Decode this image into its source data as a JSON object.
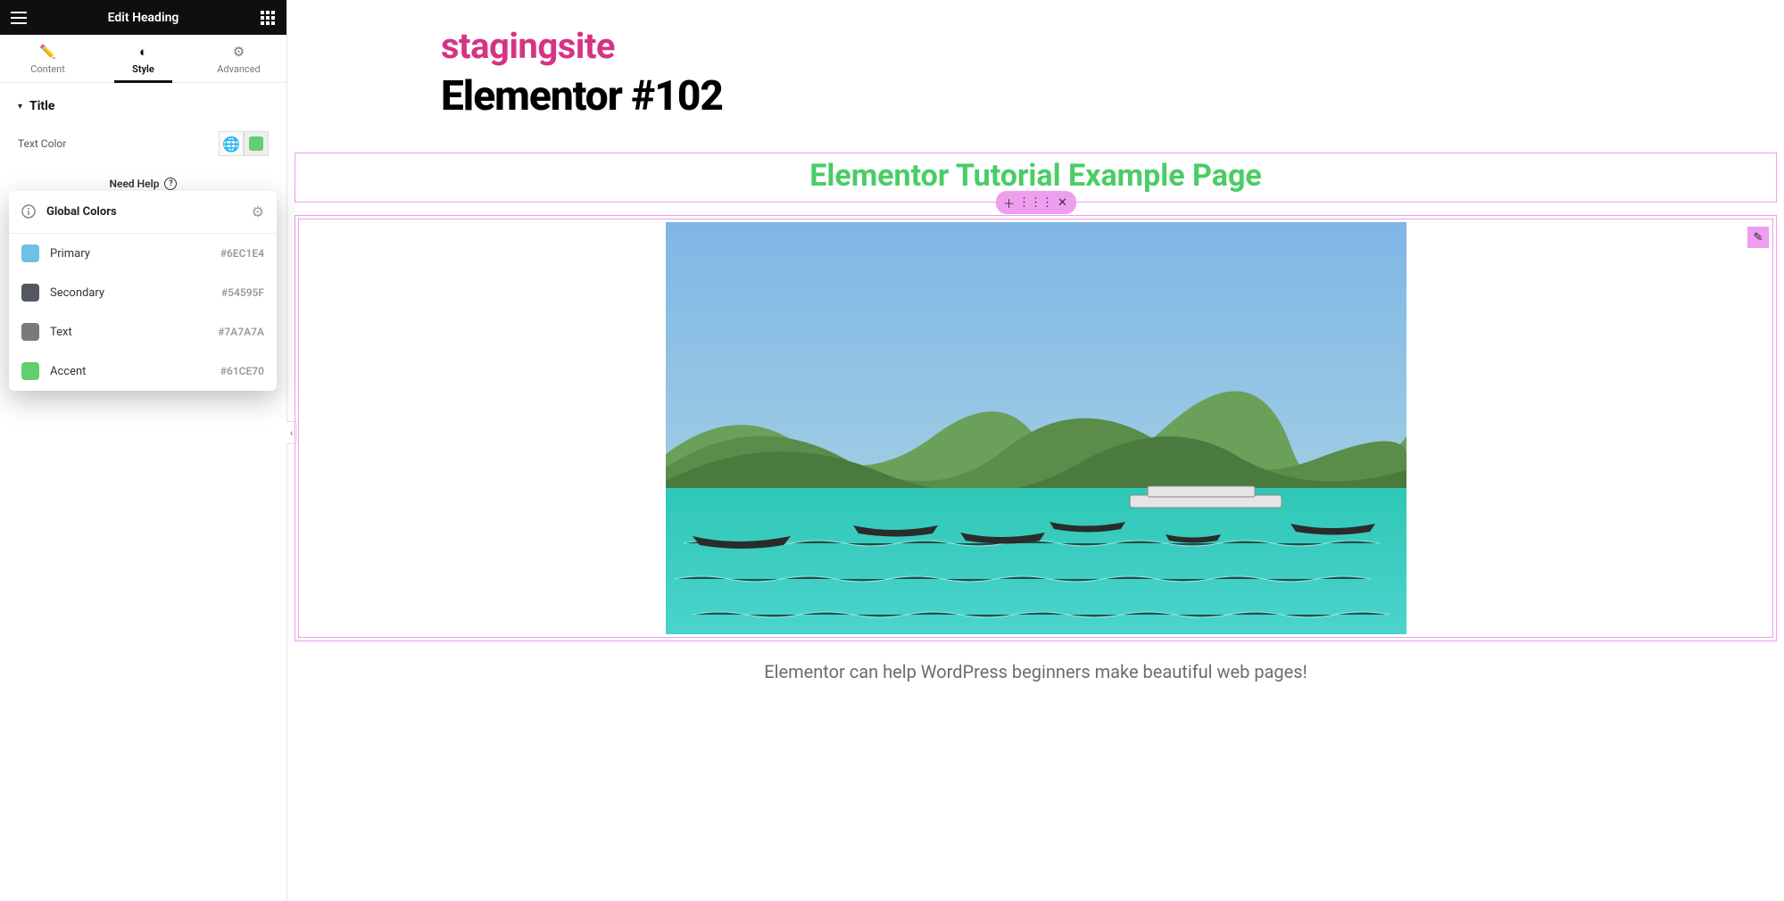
{
  "sidebar": {
    "header_title": "Edit Heading",
    "tabs": {
      "content": "Content",
      "style": "Style",
      "advanced": "Advanced"
    },
    "section": {
      "title": "Title"
    },
    "text_color_label": "Text Color",
    "selected_swatch_color": "#61CE70",
    "help": "Need Help"
  },
  "global_colors": {
    "title": "Global Colors",
    "items": [
      {
        "name": "Primary",
        "hex": "#6EC1E4",
        "swatch": "#6EC1E4"
      },
      {
        "name": "Secondary",
        "hex": "#54595F",
        "swatch": "#54595F"
      },
      {
        "name": "Text",
        "hex": "#7A7A7A",
        "swatch": "#7A7A7A"
      },
      {
        "name": "Accent",
        "hex": "#61CE70",
        "swatch": "#61CE70"
      }
    ]
  },
  "canvas": {
    "site_title": "stagingsite",
    "page_title": "Elementor #102",
    "heading_text": "Elementor Tutorial Example Page",
    "caption": "Elementor can help WordPress beginners make beautiful web pages!"
  },
  "colors": {
    "accent_pink": "#d63384",
    "heading_green": "#4acc66",
    "selection_violet": "#ee9eee"
  }
}
